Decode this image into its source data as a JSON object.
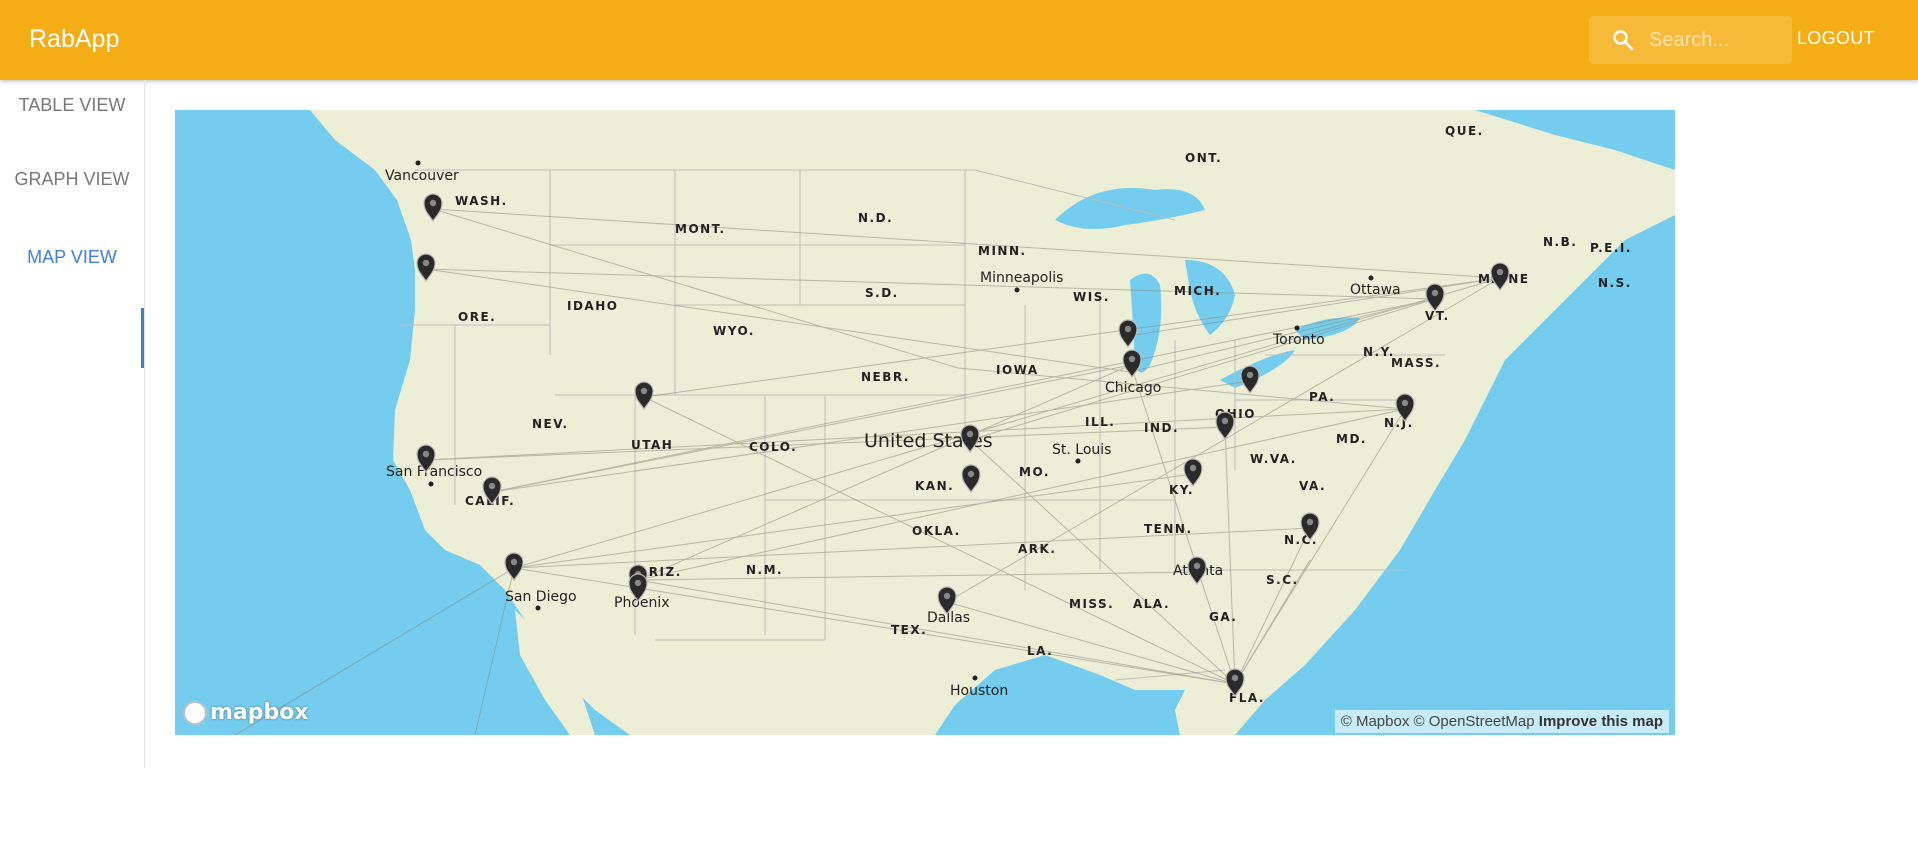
{
  "app": {
    "title": "RabApp",
    "search_placeholder": "Search...",
    "logout_label": "LOGOUT",
    "accent_color": "#f5ad16",
    "active_tab_color": "#3d7fd6"
  },
  "sidebar": {
    "tabs": [
      {
        "label": "TABLE VIEW",
        "active": false
      },
      {
        "label": "GRAPH VIEW",
        "active": false
      },
      {
        "label": "MAP VIEW",
        "active": true
      }
    ]
  },
  "map": {
    "country_label": "United States",
    "attribution": "© Mapbox © OpenStreetMap",
    "improve_link": "Improve this map",
    "logo_text": "mapbox",
    "region_labels": [
      "QUE.",
      "ONT.",
      "N.B.",
      "P.E.I.",
      "N.S.",
      "WASH.",
      "MONT.",
      "N.D.",
      "MINN.",
      "S.D.",
      "WIS.",
      "MICH.",
      "ORE.",
      "IDAHO",
      "WYO.",
      "VT.",
      "MAINE",
      "N.Y.",
      "MASS.",
      "NEBR.",
      "IOWA",
      "PA.",
      "N.J.",
      "NEV.",
      "UTAH",
      "COLO.",
      "ILL.",
      "IND.",
      "OHIO",
      "MD.",
      "W.VA.",
      "MO.",
      "KY.",
      "VA.",
      "CALIF.",
      "KAN.",
      "TENN.",
      "N.C.",
      "OKLA.",
      "ARK.",
      "ARIZ.",
      "N.M.",
      "S.C.",
      "MISS.",
      "ALA.",
      "GA.",
      "TEX.",
      "LA.",
      "FLA."
    ],
    "city_labels": [
      "Vancouver",
      "Minneapolis",
      "Ottawa",
      "Toronto",
      "Chicago",
      "St. Louis",
      "San Francisco",
      "Atlanta",
      "San Diego",
      "Phoenix",
      "Dallas",
      "Houston"
    ],
    "markers": [
      {
        "name": "Seattle"
      },
      {
        "name": "Portland"
      },
      {
        "name": "Salt Lake City"
      },
      {
        "name": "San Francisco"
      },
      {
        "name": "Fresno"
      },
      {
        "name": "Los Angeles"
      },
      {
        "name": "Phoenix"
      },
      {
        "name": "Tempe"
      },
      {
        "name": "Omaha"
      },
      {
        "name": "Kansas City"
      },
      {
        "name": "Madison"
      },
      {
        "name": "Chicago"
      },
      {
        "name": "Cleveland"
      },
      {
        "name": "Columbus"
      },
      {
        "name": "Lexington"
      },
      {
        "name": "Atlanta"
      },
      {
        "name": "Raleigh"
      },
      {
        "name": "New York"
      },
      {
        "name": "Burlington"
      },
      {
        "name": "Portland ME"
      },
      {
        "name": "Dallas"
      },
      {
        "name": "Miami"
      }
    ]
  }
}
